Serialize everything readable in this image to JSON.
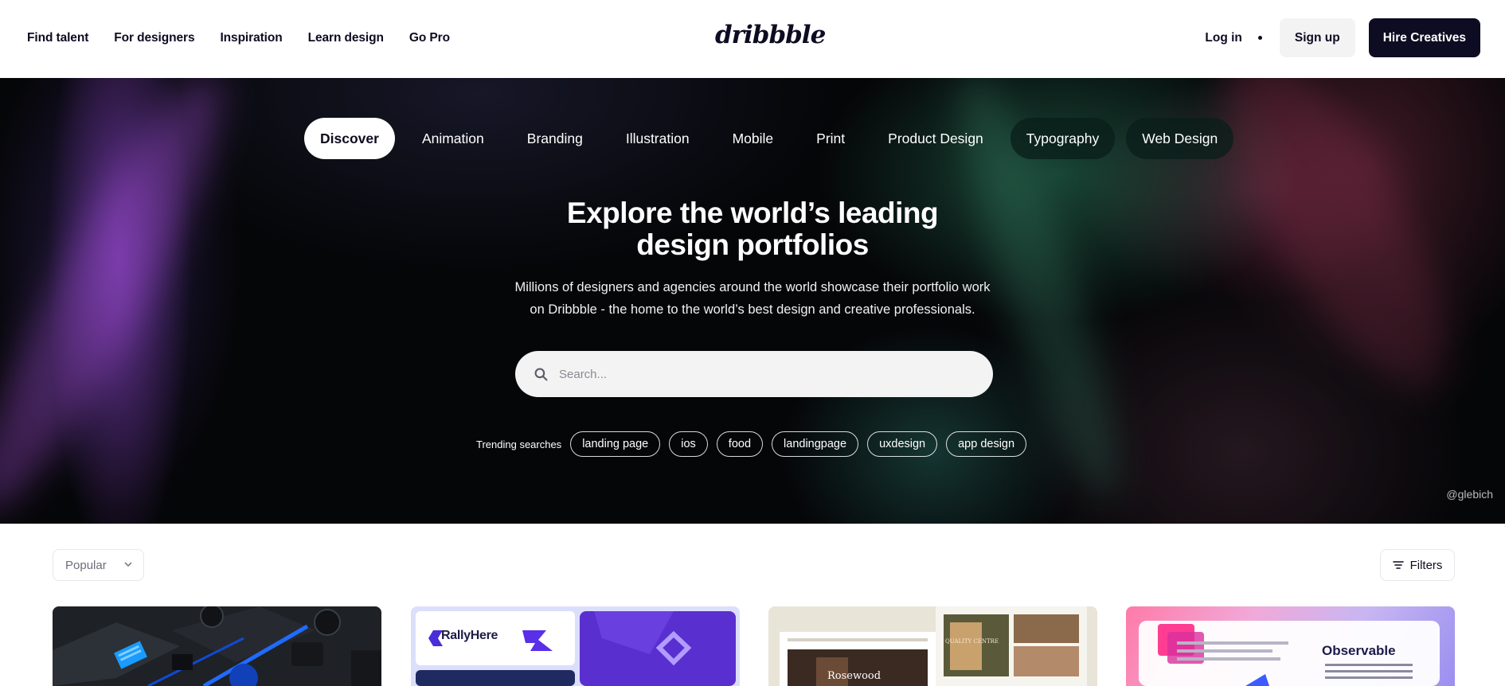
{
  "nav": {
    "links": [
      "Find talent",
      "For designers",
      "Inspiration",
      "Learn design",
      "Go Pro"
    ],
    "logo": "dribbble",
    "login": "Log in",
    "signup": "Sign up",
    "hire": "Hire Creatives"
  },
  "hero": {
    "categories": [
      "Discover",
      "Animation",
      "Branding",
      "Illustration",
      "Mobile",
      "Print",
      "Product Design",
      "Typography",
      "Web Design"
    ],
    "title_line1": "Explore the world’s leading",
    "title_line2": "design portfolios",
    "subtitle_line1": "Millions of designers and agencies around the world showcase their portfolio work",
    "subtitle_line2": "on Dribbble - the home to the world’s best design and creative professionals.",
    "search_placeholder": "Search...",
    "trending_label": "Trending searches",
    "trending": [
      "landing page",
      "ios",
      "food",
      "landingpage",
      "uxdesign",
      "app design"
    ],
    "credit": "@glebich"
  },
  "feed": {
    "sort": "Popular",
    "filters": "Filters",
    "shot2_brand": "RallyHere",
    "shot3_brand": "Rosewood",
    "shot3_sign": "QUALITY CENTRE",
    "shot4_title": "Observable"
  }
}
